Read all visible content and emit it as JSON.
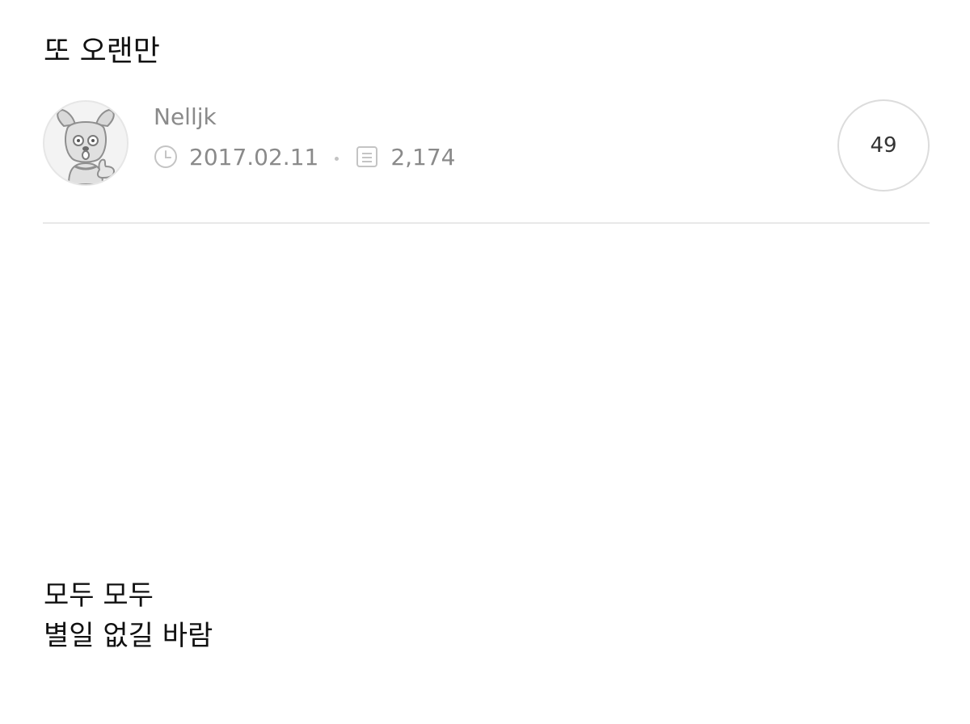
{
  "post": {
    "title": "또 오랜만",
    "author": {
      "name": "Nelljk",
      "avatar_icon": "dog-character-avatar-icon"
    },
    "meta": {
      "date": "2017.02.11",
      "date_icon": "clock-icon",
      "views": "2,174",
      "views_icon": "document-icon"
    },
    "comment_count": "49",
    "body_lines": [
      "모두 모두",
      "별일 없길 바람"
    ]
  },
  "colors": {
    "title_text": "#111111",
    "meta_text": "#8a8a8a",
    "divider": "#e8e8e8",
    "badge_border": "#dcdcdc"
  }
}
